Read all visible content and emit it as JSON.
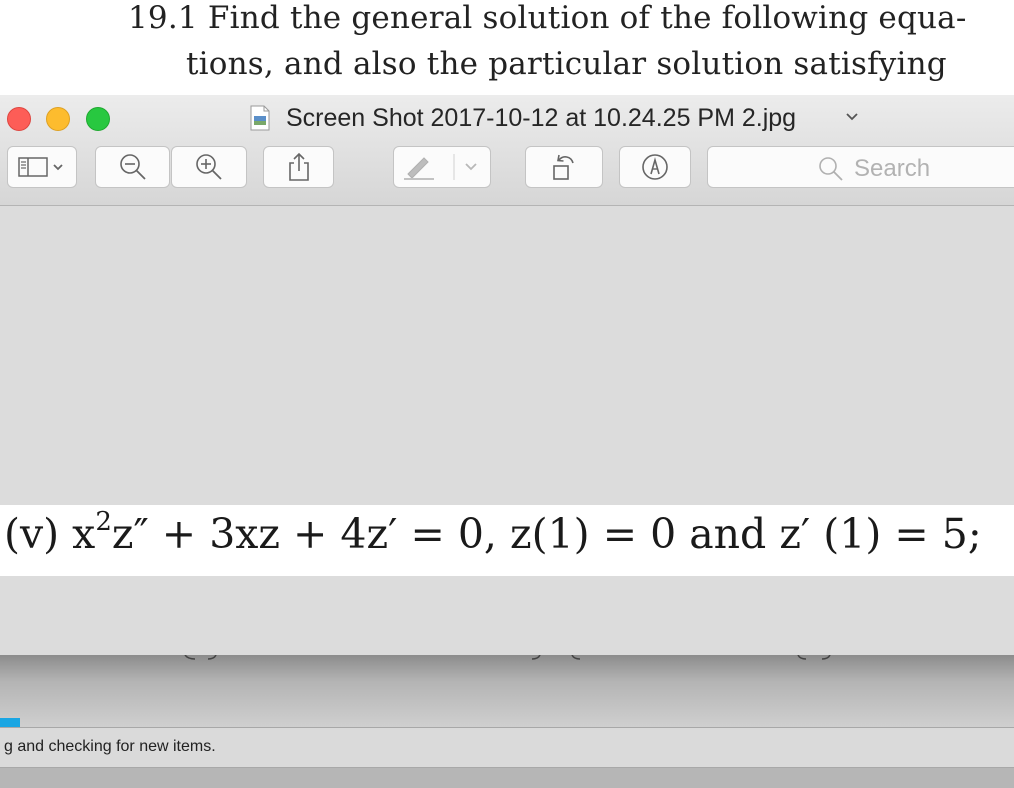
{
  "background_document": {
    "line1": "19.1  Find the general solution of the following equa-",
    "line2": "tions, and also the particular solution satisfying"
  },
  "window": {
    "title": "Screen Shot 2017-10-12 at 10.24.25 PM 2.jpg",
    "traffic_lights": {
      "close": "#fd5d57",
      "minimize": "#fdbc2e",
      "zoom": "#28c840"
    }
  },
  "toolbar": {
    "icons": [
      "sidebar-icon",
      "zoom-out-icon",
      "zoom-in-icon",
      "share-icon",
      "markup-pen-icon",
      "rotate-icon",
      "annotate-icon"
    ],
    "search_placeholder": "Search"
  },
  "image": {
    "equation_prefix": "(v) x",
    "equation_sup": "2",
    "equation_rest": "z″  +  3xz  +  4z′ = 0, z(1) = 0 and z′ (1) = 5;"
  },
  "statusbar": {
    "text": "g and checking for new items.",
    "accent": "#1aa6e3"
  }
}
